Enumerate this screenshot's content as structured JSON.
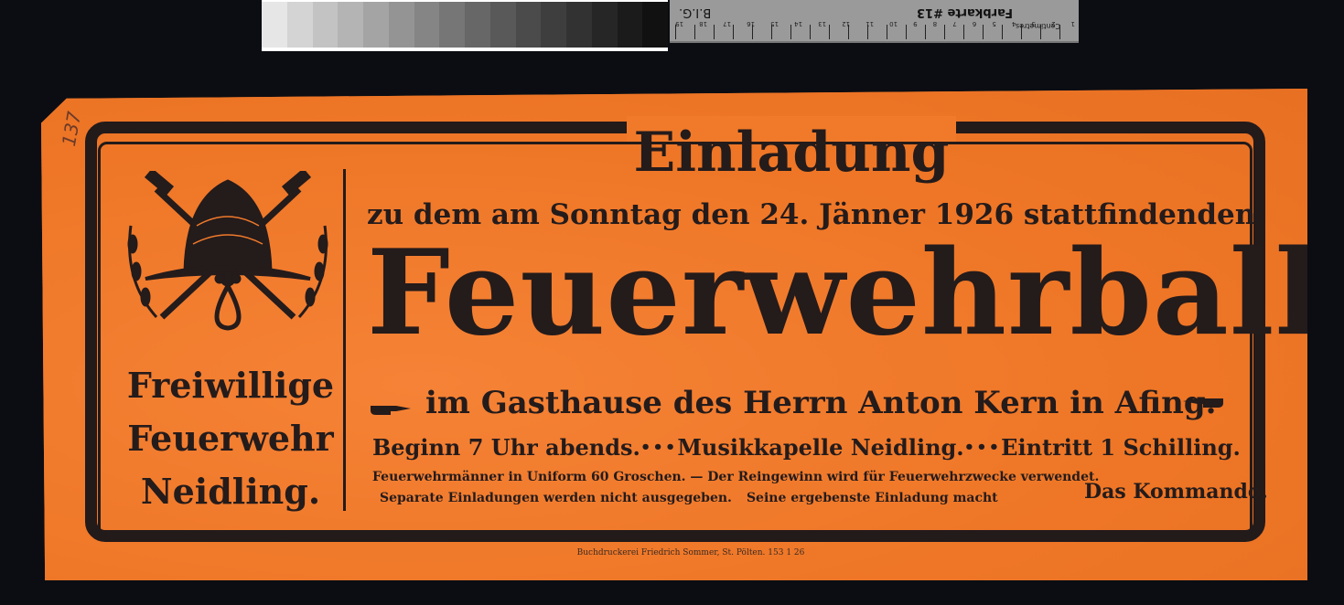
{
  "scan": {
    "ruler_label": "Farbkarte #13",
    "ruler_brand": "B.I.G.",
    "ruler_unit": "Centimetres",
    "ruler_numbers": [
      "19",
      "18",
      "17",
      "16",
      "15",
      "14",
      "13",
      "12",
      "11",
      "10",
      "9",
      "8",
      "7",
      "6",
      "5",
      "4",
      "3",
      "2",
      "1"
    ],
    "target_colors": [
      "#e6e6e6",
      "#d4d4d4",
      "#c3c3c3",
      "#b4b4b4",
      "#a4a4a4",
      "#949494",
      "#858585",
      "#767676",
      "#676767",
      "#595959",
      "#4b4b4b",
      "#3e3e3e",
      "#323232",
      "#262626",
      "#1b1b1b",
      "#111111"
    ]
  },
  "poster": {
    "inventory_mark": "137",
    "title": "Einladung",
    "subtitle": "zu dem am Sonntag den 24. Jänner 1926 stattfindenden",
    "event": "Feuerwehrball",
    "venue": "im Gasthause des Herrn Anton Kern in Afing.",
    "info": {
      "start": "Beginn 7 Uhr abends.",
      "separator": "•••",
      "music": "Musikkapelle Neidling.",
      "entry": "Eintritt 1 Schilling."
    },
    "note1": "Feuerwehrmänner in Uniform 60 Groschen. — Der Reingewinn wird für Feuerwehrzwecke verwendet.",
    "note2a": "Separate Einladungen werden nicht ausgegeben.",
    "note2b": "Seine ergebenste Einladung macht",
    "signature": "Das Kommando.",
    "org_lines": [
      "Freiwillige",
      "Feuerwehr",
      "Neidling."
    ],
    "printer": "Buchdruckerei Friedrich Sommer, St. Pölten. 153 1 26",
    "paper_color": "#f07a2a",
    "ink_color": "#241b1b"
  }
}
